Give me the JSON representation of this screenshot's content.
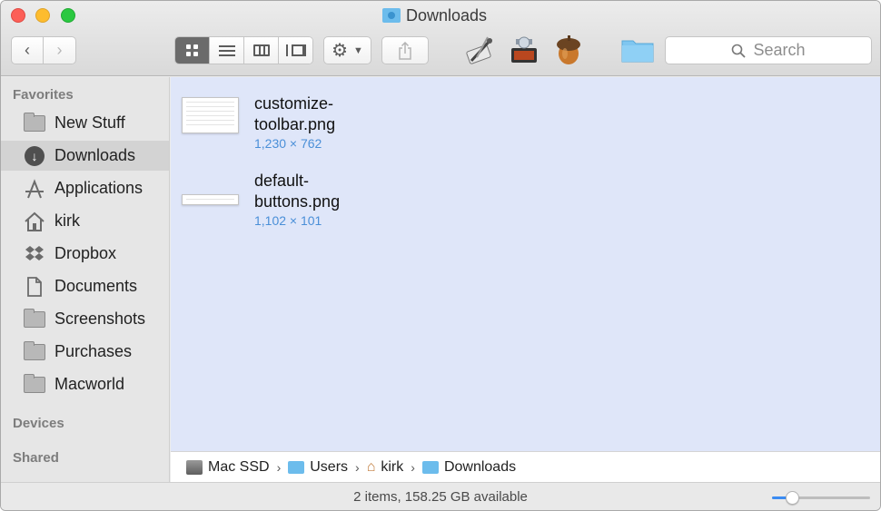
{
  "window": {
    "title": "Downloads"
  },
  "toolbar": {
    "back_icon": "chevron-left-icon",
    "forward_icon": "chevron-right-icon",
    "view_modes": [
      "icon-view",
      "list-view",
      "column-view",
      "cover-flow-view"
    ],
    "active_view": "icon-view",
    "action_icon": "gear-icon",
    "share_icon": "share-icon",
    "custom_apps": [
      "script-editor-icon",
      "automator-icon",
      "acorn-icon",
      "folder-icon"
    ],
    "search_placeholder": "Search"
  },
  "sidebar": {
    "favorites_heading": "Favorites",
    "items": [
      {
        "label": "New Stuff",
        "icon": "folder-icon"
      },
      {
        "label": "Downloads",
        "icon": "download-icon",
        "selected": true
      },
      {
        "label": "Applications",
        "icon": "applications-icon"
      },
      {
        "label": "kirk",
        "icon": "home-icon"
      },
      {
        "label": "Dropbox",
        "icon": "dropbox-icon"
      },
      {
        "label": "Documents",
        "icon": "documents-icon"
      },
      {
        "label": "Screenshots",
        "icon": "folder-icon"
      },
      {
        "label": "Purchases",
        "icon": "folder-icon"
      },
      {
        "label": "Macworld",
        "icon": "folder-icon"
      }
    ],
    "devices_heading": "Devices",
    "shared_heading": "Shared"
  },
  "files": [
    {
      "name": "customize-\ntoolbar.png",
      "dims": "1,230 × 762"
    },
    {
      "name": "default-\nbuttons.png",
      "dims": "1,102 × 101"
    }
  ],
  "pathbar": {
    "crumbs": [
      {
        "label": "Mac SSD",
        "icon": "disk-icon"
      },
      {
        "label": "Users",
        "icon": "folder-icon"
      },
      {
        "label": "kirk",
        "icon": "home-icon"
      },
      {
        "label": "Downloads",
        "icon": "downloads-folder-icon"
      }
    ],
    "separator": "›"
  },
  "status": {
    "text": "2 items, 158.25 GB available",
    "icon_size_fraction": 0.2
  },
  "colors": {
    "content_bg": "#dfe6f9",
    "accent": "#3b8cf2",
    "dims_text": "#4a8fd8"
  }
}
